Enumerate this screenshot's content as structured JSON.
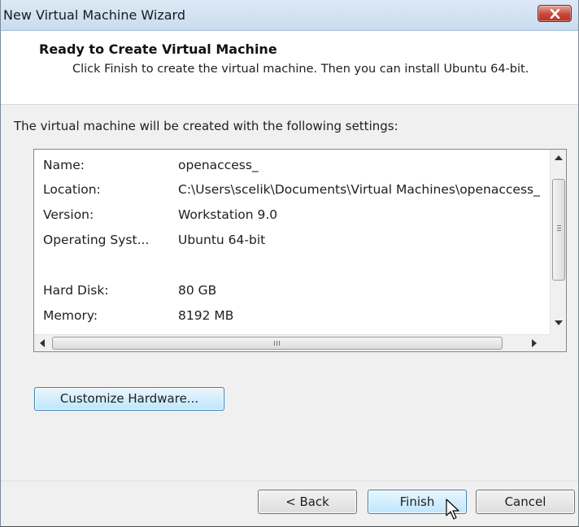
{
  "window": {
    "title": "New Virtual Machine Wizard"
  },
  "header": {
    "title": "Ready to Create Virtual Machine",
    "description": "Click Finish to create the virtual machine. Then you can install Ubuntu 64-bit."
  },
  "intro_text": "The virtual machine will be created with the following settings:",
  "settings": [
    {
      "key": "Name:",
      "value": "openaccess_"
    },
    {
      "key": "Location:",
      "value": "C:\\Users\\scelik\\Documents\\Virtual Machines\\openaccess_"
    },
    {
      "key": "Version:",
      "value": "Workstation 9.0"
    },
    {
      "key": "Operating Syst...",
      "value": "Ubuntu 64-bit"
    },
    {
      "key": "",
      "value": ""
    },
    {
      "key": "Hard Disk:",
      "value": "80 GB"
    },
    {
      "key": "Memory:",
      "value": "8192 MB"
    }
  ],
  "buttons": {
    "customize": "Customize Hardware...",
    "back": "< Back",
    "finish": "Finish",
    "cancel": "Cancel"
  },
  "colors": {
    "close_button": "#c7463a",
    "default_button": "#bee6fd",
    "titlebar": "#dce9f6"
  }
}
